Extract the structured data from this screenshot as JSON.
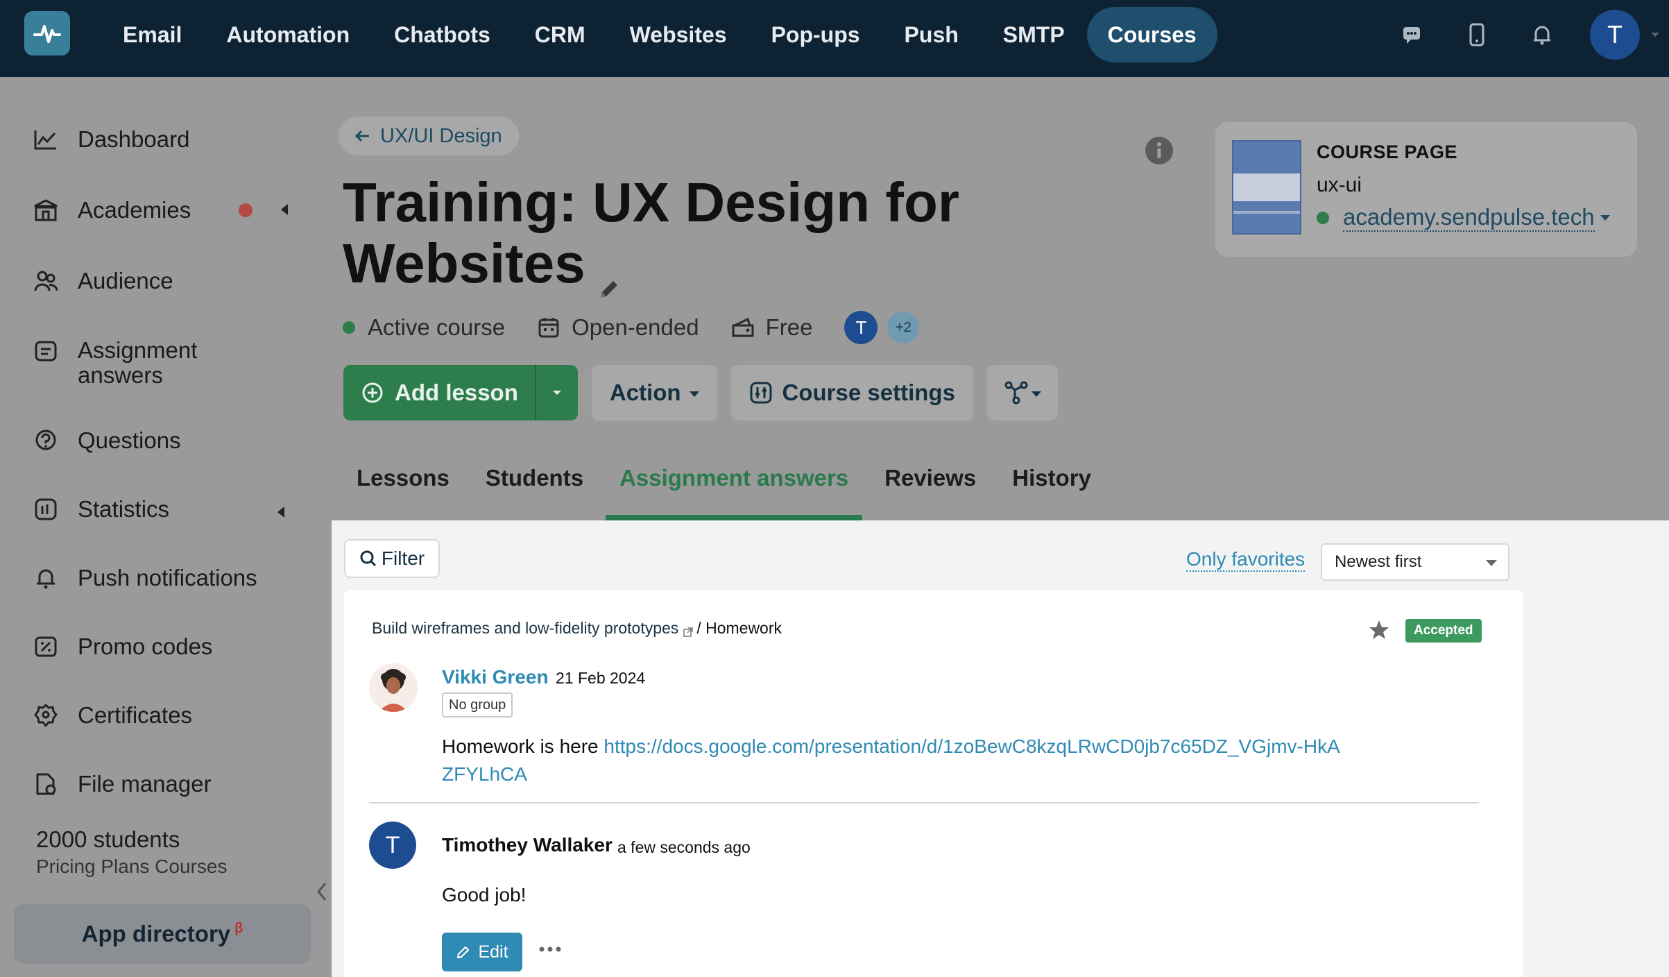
{
  "topbar": {
    "nav": [
      "Email",
      "Automation",
      "Chatbots",
      "CRM",
      "Websites",
      "Pop-ups",
      "Push",
      "SMTP",
      "Courses"
    ],
    "active": "Courses",
    "user_initial": "T"
  },
  "sidebar": {
    "items": [
      {
        "label": "Dashboard",
        "icon": "chart-line-icon"
      },
      {
        "label": "Academies",
        "icon": "academy-icon"
      },
      {
        "label": "Audience",
        "icon": "people-icon"
      },
      {
        "label": "Assignment",
        "label2": "answers",
        "icon": "assignment-icon"
      },
      {
        "label": "Questions",
        "icon": "question-icon"
      },
      {
        "label": "Statistics",
        "icon": "statistics-icon"
      },
      {
        "label": "Push notifications",
        "icon": "bell-icon"
      },
      {
        "label": "Promo codes",
        "icon": "promo-icon"
      },
      {
        "label": "Certificates",
        "icon": "certificate-icon"
      },
      {
        "label": "File manager",
        "icon": "file-icon"
      }
    ],
    "plan": {
      "students": "2000 students",
      "plan_name": "Pricing Plans Courses"
    },
    "app_directory": "App directory",
    "beta": "β"
  },
  "header": {
    "back_label": "UX/UI Design",
    "title_line1": "Training: UX Design for",
    "title_line2": "Websites",
    "status": "Active course",
    "duration": "Open-ended",
    "price": "Free",
    "team_initial": "T",
    "team_more": "+2"
  },
  "course_page": {
    "label": "COURSE PAGE",
    "slug": "ux-ui",
    "domain": "academy.sendpulse.tech"
  },
  "actions": {
    "add_lesson": "Add lesson",
    "action": "Action",
    "course_settings": "Course settings"
  },
  "tabs": [
    "Lessons",
    "Students",
    "Assignment answers",
    "Reviews",
    "History"
  ],
  "active_tab": "Assignment answers",
  "toolbar": {
    "filter": "Filter",
    "only_favorites": "Only favorites",
    "sort": "Newest first"
  },
  "answer": {
    "lesson": "Build wireframes and low-fidelity prototypes",
    "section": "/ Homework",
    "status": "Accepted",
    "student_name": "Vikki Green",
    "date": "21 Feb 2024",
    "group": "No group",
    "text_prefix": "Homework is here ",
    "link": "https://docs.google.com/presentation/d/1zoBewC8kzqLRwCD0jb7c65DZ_VGjmv-HkAZFYLhCA",
    "reply": {
      "author_initial": "T",
      "author": "Timothey Wallaker",
      "time": "a few seconds ago",
      "text": "Good job!",
      "edit": "Edit"
    }
  },
  "colors": {
    "topbar": "#0d2334",
    "accent_green": "#2d7d4d",
    "link_blue": "#2f8ab4",
    "accepted": "#3d9a5f"
  }
}
